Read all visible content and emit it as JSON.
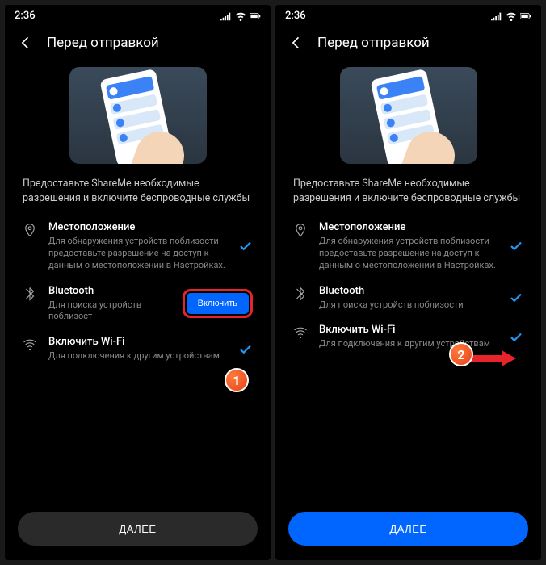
{
  "status": {
    "time": "2:36"
  },
  "header": {
    "title": "Перед отправкой"
  },
  "subtitle": "Предоставьте ShareMe необходимые разрешения и включите беспроводные службы",
  "perms": {
    "location": {
      "title": "Местоположение",
      "desc": "Для обнаружения устройств поблизости предоставьте разрешение на доступ к данным о местоположении в Настройках."
    },
    "bluetooth": {
      "title": "Bluetooth",
      "desc_left": "Для поиска устройств поблизост",
      "desc_right": "Для поиска устройств поблизости",
      "enable": "Включить"
    },
    "wifi": {
      "title": "Включить Wi-Fi",
      "desc": "Для подключения к другим устройствам"
    }
  },
  "next": "ДАЛЕЕ",
  "markers": {
    "one": "1",
    "two": "2"
  }
}
